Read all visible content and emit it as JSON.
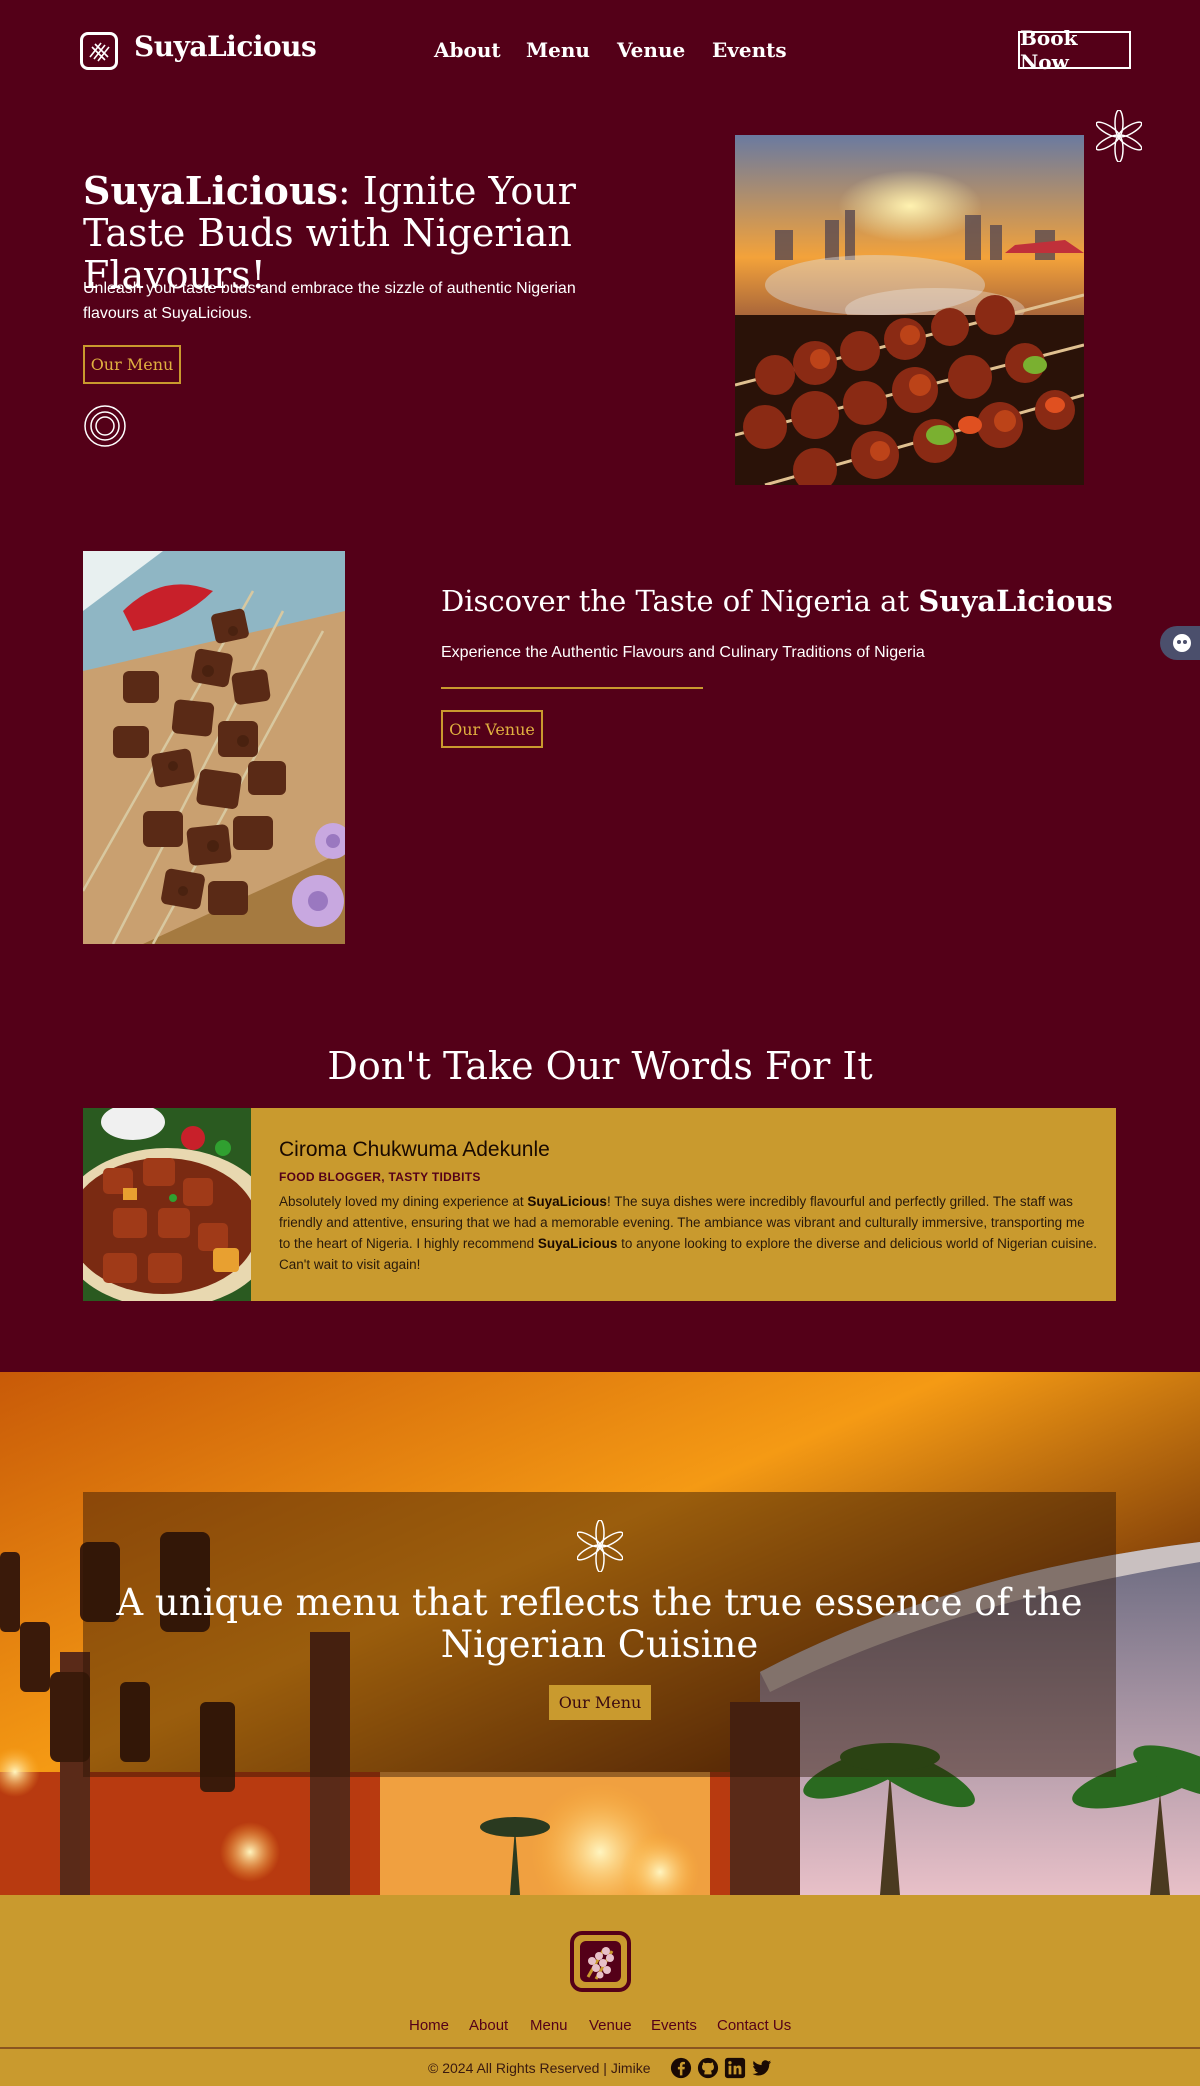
{
  "header": {
    "logo_text": "SuyaLicious",
    "nav": [
      "About",
      "Menu",
      "Venue",
      "Events"
    ],
    "book_label": "Book Now"
  },
  "hero": {
    "title_brand": "SuyaLicious",
    "title_rest": ": Ignite Your Taste Buds with Nigerian Flavours!",
    "description": "Unleash your taste buds and embrace the sizzle of authentic Nigerian flavours at SuyaLicious.",
    "button_label": "Our Menu"
  },
  "discover": {
    "title_prefix": "Discover the Taste of Nigeria at ",
    "title_brand": "SuyaLicious",
    "subtitle": "Experience the Authentic Flavours and Culinary Traditions of Nigeria",
    "button_label": "Our Venue"
  },
  "testimonials": {
    "title": "Don't Take Our Words For It",
    "name": "Ciroma Chukwuma Adekunle",
    "role": "FOOD BLOGGER, TASTY TIDBITS",
    "text_1": "Absolutely loved my dining experience at ",
    "brand_1": "SuyaLicious",
    "text_2": "! The suya dishes were incredibly flavourful and perfectly grilled. The staff was friendly and attentive, ensuring that we had a memorable evening. The ambiance was vibrant and culturally immersive, transporting me to the heart of Nigeria. I highly recommend ",
    "brand_2": "SuyaLicious",
    "text_3": " to anyone looking to explore the diverse and delicious world of Nigerian cuisine. Can't wait to visit again!"
  },
  "banner": {
    "title": "A unique menu that reflects the true essence of the Nigerian Cuisine",
    "button_label": "Our Menu"
  },
  "footer": {
    "links": [
      "Home",
      "About",
      "Menu",
      "Venue",
      "Events",
      "Contact Us"
    ],
    "copyright": "© 2024 All Rights Reserved | Jimike",
    "social_icons": [
      "facebook-icon",
      "github-icon",
      "linkedin-icon",
      "twitter-icon"
    ]
  },
  "colors": {
    "background": "#540018",
    "gold": "#c99a2e",
    "white": "#ffffff"
  }
}
